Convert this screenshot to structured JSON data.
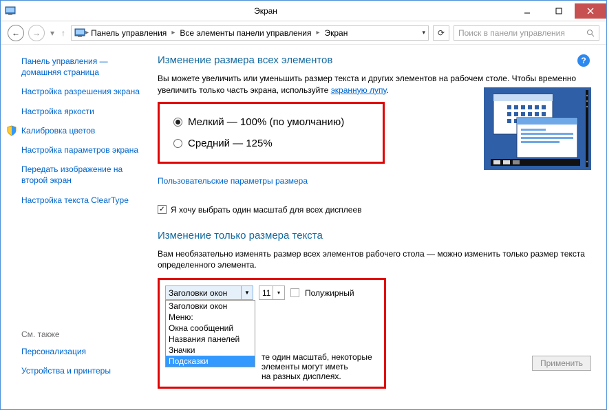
{
  "window": {
    "title": "Экран"
  },
  "breadcrumb": {
    "parts": [
      "Панель управления",
      "Все элементы панели управления",
      "Экран"
    ]
  },
  "search": {
    "placeholder": "Поиск в панели управления"
  },
  "sidebar": {
    "home": "Панель управления — домашняя страница",
    "items": [
      "Настройка разрешения экрана",
      "Настройка яркости",
      "Калибровка цветов",
      "Настройка параметров экрана",
      "Передать изображение на второй экран",
      "Настройка текста ClearType"
    ],
    "see_also": "См. также",
    "see_items": [
      "Персонализация",
      "Устройства и принтеры"
    ]
  },
  "main": {
    "h1a": "Изменение размера всех элементов",
    "p1a": "Вы можете увеличить или уменьшить размер текста и других элементов на рабочем столе. Чтобы временно увеличить только часть экрана, используйте ",
    "p1link": "экранную лупу",
    "p1b": ".",
    "radio_small": "Мелкий — 100% (по умолчанию)",
    "radio_medium": "Средний — 125%",
    "custom_link": "Пользовательские параметры размера",
    "chk_label": "Я хочу выбрать один масштаб для всех дисплеев",
    "h1b": "Изменение только размера текста",
    "p2": "Вам необязательно изменять размер всех элементов рабочего стола — можно изменить только размер текста определенного элемента.",
    "sel_element": "Заголовки окон",
    "sel_size": "11",
    "bold_label": "Полужирный",
    "options": [
      "Заголовки окон",
      "Меню:",
      "Окна сообщений",
      "Названия панелей",
      "Значки",
      "Подсказки"
    ],
    "note_a": "те один масштаб, некоторые элементы могут иметь",
    "note_b": "на разных дисплеях.",
    "apply": "Применить"
  }
}
